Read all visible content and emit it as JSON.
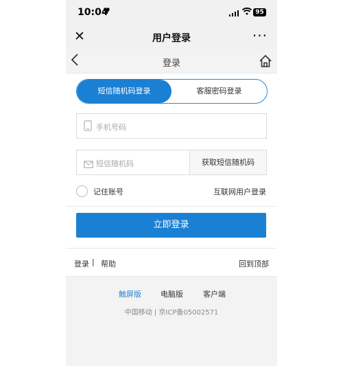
{
  "status_bar": {
    "time": "10:04",
    "battery": "95"
  },
  "top_nav": {
    "title": "用户登录",
    "close": "✕",
    "more": "···"
  },
  "sub_header": {
    "title": "登录"
  },
  "tabs": [
    {
      "label": "短信随机码登录",
      "active": true
    },
    {
      "label": "客服密码登录",
      "active": false
    }
  ],
  "form": {
    "phone_placeholder": "手机号码",
    "code_placeholder": "短信随机码",
    "get_code_label": "获取短信随机码",
    "remember_label": "记住账号",
    "internet_login_label": "互联网用户登录",
    "submit_label": "立即登录"
  },
  "footer_links": {
    "login": "登录",
    "separator": "|",
    "help": "帮助",
    "back_to_top": "回到顶部"
  },
  "footer": {
    "versions": [
      "触屏版",
      "电脑版",
      "客户端"
    ],
    "copyright": "中国移动 | 京ICP备05002571"
  },
  "colors": {
    "accent": "#1a80d3",
    "link_active": "#2a86d1"
  }
}
